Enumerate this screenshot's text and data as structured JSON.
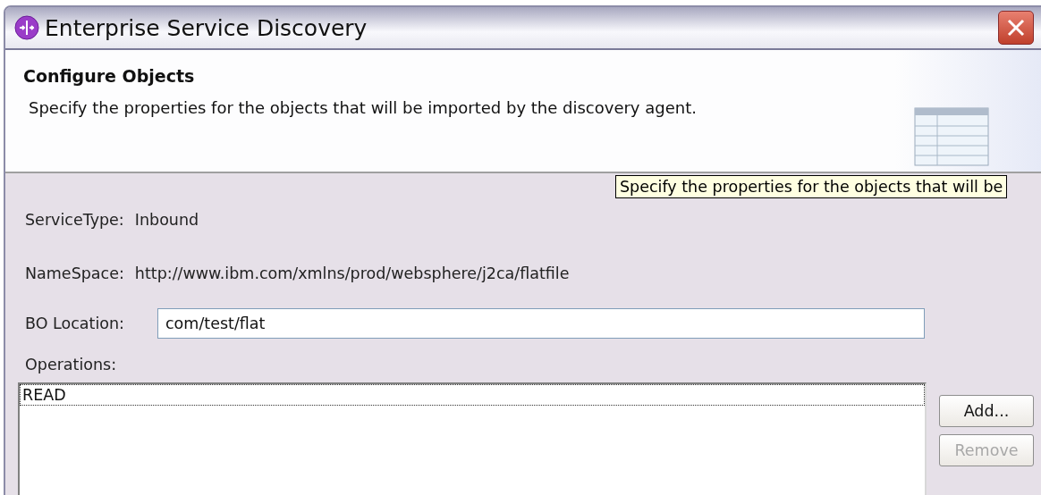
{
  "window": {
    "title": "Enterprise Service Discovery"
  },
  "header": {
    "title": "Configure Objects",
    "description": "Specify the properties for the objects that will be imported by the discovery agent."
  },
  "tooltip": {
    "text": "Specify the properties for the objects that will be"
  },
  "fields": [
    {
      "kind": "static",
      "label": "ServiceType:",
      "value": "Inbound"
    },
    {
      "kind": "static",
      "label": "NameSpace:",
      "value": "http://www.ibm.com/xmlns/prod/websphere/j2ca/flatfile"
    },
    {
      "kind": "input",
      "label": "BO Location:",
      "value": "com/test/flat"
    }
  ],
  "operations": {
    "label": "Operations:",
    "items": [
      {
        "text": "READ",
        "focused": true
      }
    ],
    "buttons": [
      {
        "label": "Add...",
        "disabled": false
      },
      {
        "label": "Remove",
        "disabled": true
      }
    ]
  }
}
